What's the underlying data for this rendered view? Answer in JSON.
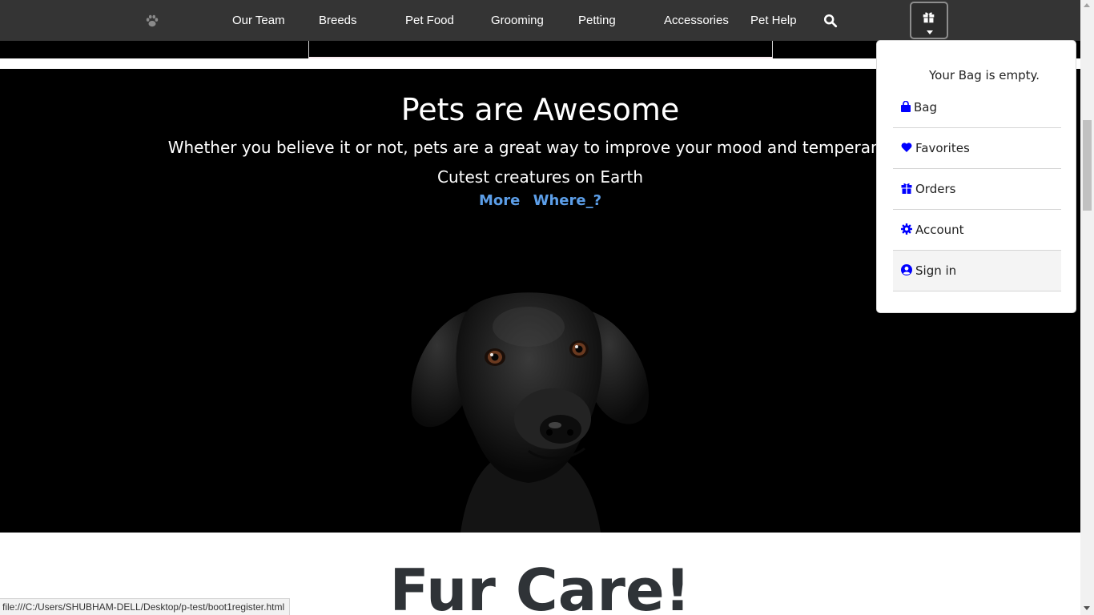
{
  "navbar": {
    "logo_icon": "paw-icon",
    "links": [
      "Our Team",
      "Breeds",
      "Pet Food",
      "Grooming",
      "Petting",
      "Accessories",
      "Pet Help"
    ],
    "search_icon": "search-icon",
    "bag_icon": "gift-icon"
  },
  "hero": {
    "title": "Pets are Awesome",
    "subtitle": "Whether you believe it or not, pets are a great way to improve your mood and temperament",
    "tagline": "Cutest creatures on Earth",
    "link_more": "More",
    "link_where": "Where_?"
  },
  "section": {
    "heading": "Fur Care!"
  },
  "bag_dropdown": {
    "empty_text": "Your Bag is empty.",
    "items": [
      {
        "label": "Bag",
        "icon": "shopping-bag-icon"
      },
      {
        "label": "Favorites",
        "icon": "heart-icon"
      },
      {
        "label": "Orders",
        "icon": "box-icon"
      },
      {
        "label": "Account",
        "icon": "gear-icon"
      },
      {
        "label": "Sign in",
        "icon": "user-circle-icon"
      }
    ],
    "icon_color": "#0000ff"
  },
  "status_bar": {
    "url": "file:///C:/Users/SHUBHAM-DELL/Desktop/p-test/boot1register.html"
  },
  "colors": {
    "navbar_bg": "#343434",
    "hero_bg": "#000000",
    "link_color": "#5c9ee8"
  }
}
